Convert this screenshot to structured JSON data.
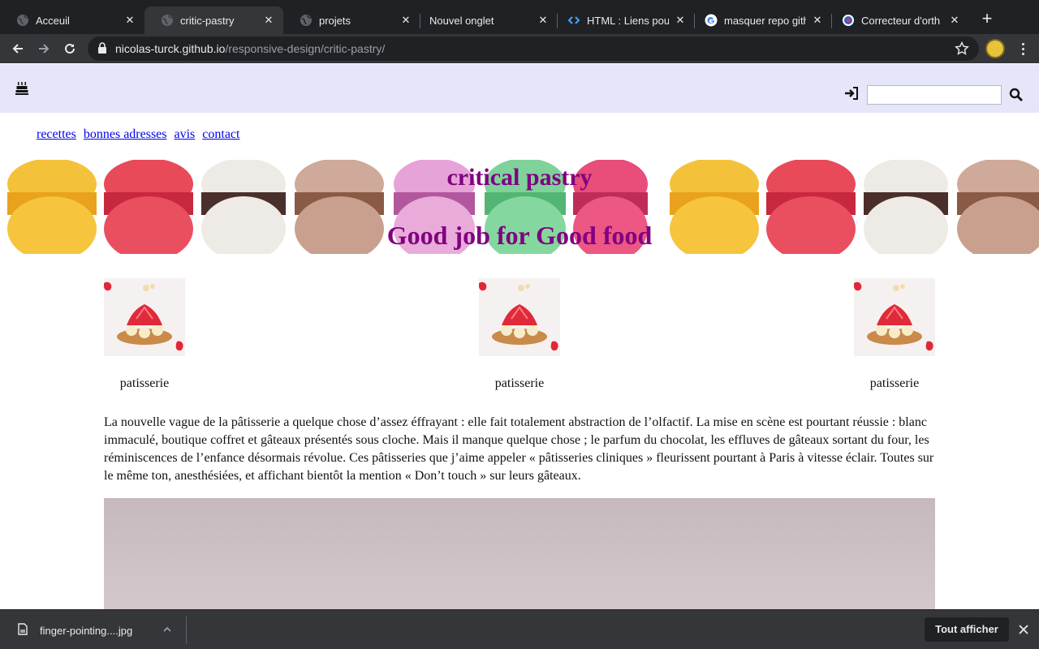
{
  "browser": {
    "tabs": [
      {
        "title": "Acceuil",
        "favicon": "globe-icon",
        "active": false
      },
      {
        "title": "critic-pastry",
        "favicon": "globe-icon",
        "active": true
      },
      {
        "title": "projets",
        "favicon": "globe-icon",
        "active": false
      },
      {
        "title": "Nouvel onglet",
        "favicon": "",
        "active": false
      },
      {
        "title": "HTML : Liens pour",
        "favicon": "code-icon",
        "active": false
      },
      {
        "title": "masquer repo gith",
        "favicon": "google-icon",
        "active": false
      },
      {
        "title": "Correcteur d'orth",
        "favicon": "scribens-icon",
        "active": false
      }
    ],
    "url_domain": "nicolas-turck.github.io",
    "url_path": "/responsive-design/critic-pastry/"
  },
  "site": {
    "title": "critical pastry",
    "slogan": "Good job for Good food",
    "search_value": "",
    "nav": [
      "recettes",
      "bonnes adresses",
      "avis",
      "contact"
    ],
    "cards": [
      {
        "label": "patisserie"
      },
      {
        "label": "patisserie"
      },
      {
        "label": "patisserie"
      }
    ],
    "article": "La nouvelle vague de la pâtisserie a quelque chose d’assez éffrayant : elle fait totalement abstraction de l’olfactif. La mise en scène est pourtant réussie : blanc immaculé, boutique coffret et gâteaux présentés sous cloche. Mais il manque quelque chose ; le parfum du chocolat, les effluves de gâteaux sortant du four, les réminiscences de l’enfance désormais révolue. Ces pâtisseries que j’aime appeler « pâtisseries cliniques » fleurissent pourtant à Paris à vitesse éclair. Toutes sur le même ton, anesthésiées, et affichant bientôt la mention « Don’t touch » sur leurs gâteaux.",
    "colors": {
      "header_bg": "#e6e6fa",
      "title": "#800080",
      "link": "#0000ee"
    }
  },
  "downloads": {
    "file_name": "finger-pointing....jpg",
    "show_all": "Tout afficher"
  }
}
